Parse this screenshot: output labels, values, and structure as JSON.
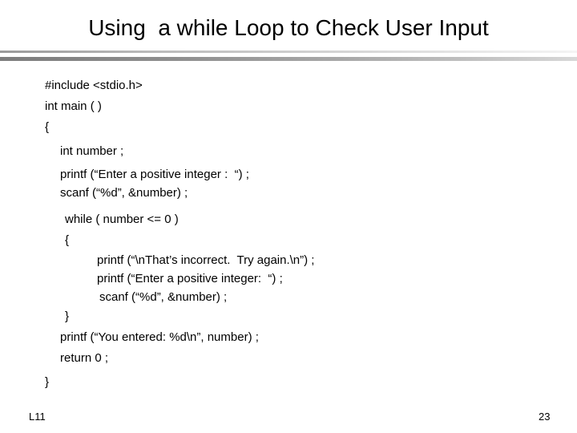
{
  "slide": {
    "title": "Using  a while Loop to Check User Input",
    "footer_left": "L11",
    "page_number": "23",
    "colors": {
      "background": "#ffffff",
      "text": "#000000",
      "rule_dark": "#7d7d7d",
      "rule_light": "#d8d8d8"
    }
  },
  "code": {
    "lines": [
      {
        "text": "#include <stdio.h>",
        "indent": 0
      },
      {
        "text": "int main ( )",
        "indent": 0
      },
      {
        "text": "{",
        "indent": 0
      },
      {
        "text": "int number ;",
        "indent": 1
      },
      {
        "text": "printf (“Enter a positive integer :  “) ;",
        "indent": 1
      },
      {
        "text": "scanf (“%d”, &number) ;",
        "indent": 1
      },
      {
        "text": "while ( number <= 0 )",
        "indent": 2
      },
      {
        "text": "{",
        "indent": 2
      },
      {
        "text": "printf (“\\nThat’s incorrect.  Try again.\\n”) ;",
        "indent": 3
      },
      {
        "text": "printf (“Enter a positive integer:  “) ;",
        "indent": 3
      },
      {
        "text": "scanf (“%d”, &number) ;",
        "indent": 4
      },
      {
        "text": "}",
        "indent": 2
      },
      {
        "text": "printf (“You entered: %d\\n”, number) ;",
        "indent": 1
      },
      {
        "text": "return 0 ;",
        "indent": 1
      },
      {
        "text": "}",
        "indent": 0
      }
    ]
  }
}
